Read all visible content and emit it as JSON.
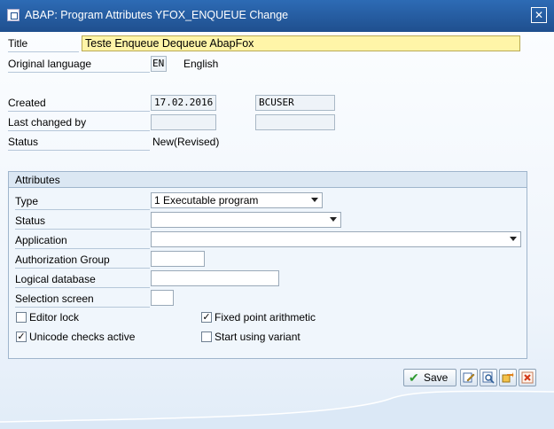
{
  "window": {
    "title": "ABAP: Program Attributes YFOX_ENQUEUE Change",
    "close_glyph": "✕"
  },
  "form": {
    "title_label": "Title",
    "title_value": "Teste Enqueue Dequeue AbapFox",
    "orig_lang_label": "Original language",
    "orig_lang_code": "EN",
    "orig_lang_name": "English",
    "created_label": "Created",
    "created_date": "17.02.2016",
    "created_user": "BCUSER",
    "last_changed_label": "Last changed by",
    "last_changed_date": "",
    "last_changed_user": "",
    "status_label": "Status",
    "status_value": "New(Revised)"
  },
  "attributes": {
    "header": "Attributes",
    "type_label": "Type",
    "type_value": "1 Executable program",
    "status_label": "Status",
    "status_value": "",
    "application_label": "Application",
    "application_value": "",
    "auth_group_label": "Authorization Group",
    "auth_group_value": "",
    "logical_db_label": "Logical database",
    "logical_db_value": "",
    "selection_screen_label": "Selection screen",
    "selection_screen_value": "",
    "checkboxes": {
      "editor_lock": {
        "label": "Editor lock",
        "checked": false
      },
      "unicode_checks": {
        "label": "Unicode checks active",
        "checked": true
      },
      "fixed_point": {
        "label": "Fixed point arithmetic",
        "checked": true
      },
      "start_variant": {
        "label": "Start using variant",
        "checked": false
      }
    }
  },
  "footer": {
    "save_label": "Save",
    "icons": [
      "edit-icon",
      "find-icon",
      "transfer-icon",
      "cancel-icon"
    ]
  },
  "colors": {
    "title_bar": "#2d6bb5",
    "title_field": "#fff5a8",
    "save_check": "#2f9a2f",
    "cancel": "#d43b1a"
  }
}
